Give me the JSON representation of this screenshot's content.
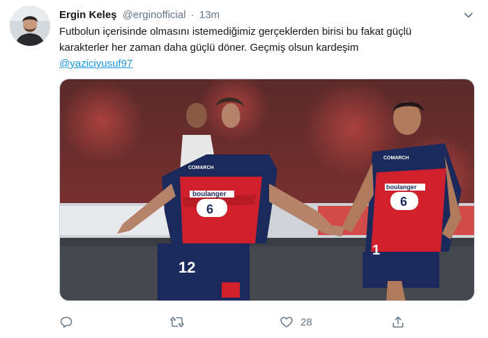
{
  "tweet": {
    "author_name": "Ergin Keleş",
    "author_handle": "@erginofficial",
    "separator": "·",
    "time": "13m",
    "text_line1": "Futbolun içerisinde olmasını istemediğimiz gerçeklerden birisi bu fakat güçlü",
    "text_line2": "karakterler her zaman daha güçlü döner. Geçmiş olsun kardeşim",
    "mention": "@yaziciyusuf97",
    "photo_texts": {
      "sponsor_left": "boulanger",
      "number_left": "6",
      "shirt_number": "12",
      "brand_left": "COMARCH",
      "sponsor_right": "boulanger",
      "number_right": "6",
      "shirt_number_right": "1",
      "brand_right": "COMARCH"
    }
  },
  "actions": {
    "reply_count": "",
    "retweet_count": "",
    "like_count": "28"
  },
  "colors": {
    "link": "#1b95e0",
    "muted": "#657786",
    "jersey_navy": "#1b2a5a",
    "jersey_red": "#d0202e"
  },
  "icons": [
    "chevron-down-icon",
    "reply-icon",
    "retweet-icon",
    "like-icon",
    "share-icon"
  ]
}
